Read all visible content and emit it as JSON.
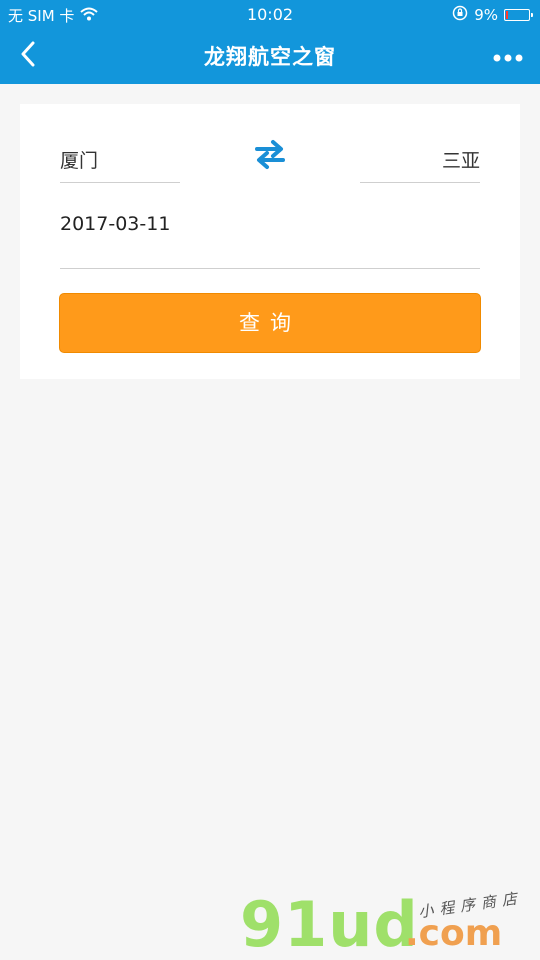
{
  "status_bar": {
    "carrier": "无 SIM 卡",
    "time": "10:02",
    "battery_percent": "9%",
    "battery_level": 0.09,
    "icons": [
      "wifi-icon",
      "orientation-lock-icon",
      "battery-icon"
    ]
  },
  "nav": {
    "title": "龙翔航空之窗",
    "icons": [
      "back-chevron-icon",
      "more-dots-icon"
    ]
  },
  "search": {
    "from_city": "厦门",
    "to_city": "三亚",
    "date": "2017-03-11",
    "query_label": "查询",
    "swap_icon": "swap-arrows-icon"
  },
  "watermark": {
    "brand": "91ud",
    "domain": ".com",
    "tagline": "小程序商店"
  },
  "colors": {
    "primary": "#1296db",
    "accent": "#ff9a1a",
    "background": "#f6f6f6"
  }
}
